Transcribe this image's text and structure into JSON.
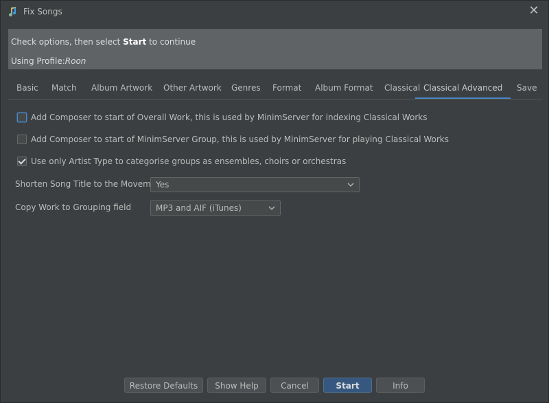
{
  "window": {
    "title": "Fix Songs",
    "close_symbol": "✕"
  },
  "info": {
    "line1_prefix": "Check options, then select ",
    "line1_bold": "Start",
    "line1_suffix": " to continue",
    "line2_prefix": "Using Profile:",
    "line2_profile": "Roon"
  },
  "tabs": [
    {
      "label": "Basic"
    },
    {
      "label": "Match"
    },
    {
      "label": "Album Artwork"
    },
    {
      "label": "Other Artwork"
    },
    {
      "label": "Genres"
    },
    {
      "label": "Format"
    },
    {
      "label": "Album Format"
    },
    {
      "label": "Classical"
    },
    {
      "label": "Classical Advanced"
    },
    {
      "label": "Save"
    }
  ],
  "options": {
    "composer_overall_work": {
      "label": "Add Composer to start of Overall Work, this is used by MinimServer for indexing Classical Works",
      "checked": false
    },
    "composer_minimserver_group": {
      "label": "Add Composer to start of MinimServer Group, this is used by MinimServer for playing Classical Works",
      "checked": false
    },
    "artist_type_categorise": {
      "label": "Use only Artist Type to categorise groups as ensembles, choirs or orchestras",
      "checked": true
    }
  },
  "fields": {
    "shorten_title": {
      "label": "Shorten Song Title to the Movement",
      "value": "Yes"
    },
    "copy_work": {
      "label": "Copy Work to Grouping field",
      "value": "MP3 and AIF (iTunes)"
    }
  },
  "buttons": {
    "restore_defaults": "Restore Defaults",
    "show_help": "Show Help",
    "cancel": "Cancel",
    "start": "Start",
    "info": "Info"
  },
  "colors": {
    "background": "#3c3f41",
    "accent": "#4a88c7",
    "primary_button": "#365880",
    "info_panel": "#606366"
  }
}
